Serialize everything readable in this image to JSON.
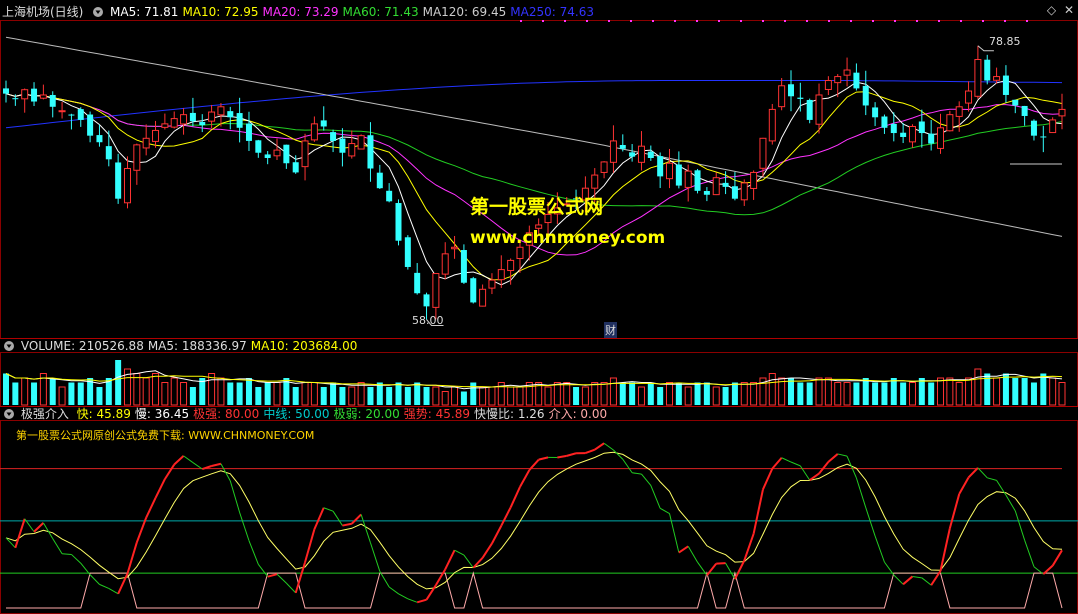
{
  "main_header": {
    "stock": "上海机场(日线)",
    "items": [
      {
        "label": "MA5: 71.81",
        "color": "#ffffff"
      },
      {
        "label": "MA10: 72.95",
        "color": "#ffff00"
      },
      {
        "label": "MA20: 73.29",
        "color": "#ff33ff"
      },
      {
        "label": "MA60: 71.43",
        "color": "#33dd33"
      },
      {
        "label": "MA120: 69.45",
        "color": "#cccccc"
      },
      {
        "label": "MA250: 74.63",
        "color": "#3333ff"
      }
    ]
  },
  "volume_header": {
    "items": [
      {
        "label": "VOLUME: 210526.88",
        "color": "#dddddd"
      },
      {
        "label": "MA5: 188336.97",
        "color": "#dddddd"
      },
      {
        "label": "MA10: 203684.00",
        "color": "#ffff00"
      }
    ]
  },
  "indicator_header": {
    "name": "极强介入",
    "items": [
      {
        "label": "快: 45.89",
        "color": "#ffff00"
      },
      {
        "label": "慢: 36.45",
        "color": "#ffffff"
      },
      {
        "label": "极强: 80.00",
        "color": "#ff3333"
      },
      {
        "label": "中线: 50.00",
        "color": "#00cccc"
      },
      {
        "label": "极弱: 20.00",
        "color": "#33dd33"
      },
      {
        "label": "强势: 45.89",
        "color": "#ff3333"
      },
      {
        "label": "快慢比: 1.26",
        "color": "#dddddd"
      },
      {
        "label": "介入: 0.00",
        "color": "#ffaaaa"
      }
    ]
  },
  "watermark": {
    "line1": "第一股票公式网",
    "line2": "www.chnmoney.com",
    "sub": "第一股票公式网原创公式免费下载: WWW.CHNMONEY.COM"
  },
  "annotations": {
    "high": "78.85",
    "low": "58.00",
    "marker": "财"
  },
  "icons": [
    "collapse-triangle-icon",
    "diamond-icon",
    "close-icon"
  ],
  "chart_data": {
    "type": "candlestick",
    "panels": [
      "price",
      "volume",
      "indicator"
    ],
    "price": {
      "high_label": 78.85,
      "low_label": 58.0,
      "close": [
        75.2,
        74.8,
        75.5,
        74.6,
        75.1,
        74.2,
        73.9,
        73.6,
        73.2,
        72.0,
        71.5,
        70.2,
        67.2,
        69.5,
        71.3,
        71.8,
        72.4,
        72.9,
        73.3,
        73.6,
        73.1,
        72.8,
        73.8,
        74.2,
        73.4,
        72.6,
        71.6,
        70.7,
        70.3,
        70.9,
        69.9,
        69.2,
        71.6,
        72.9,
        72.7,
        71.6,
        70.7,
        71.4,
        72.0,
        69.5,
        68.0,
        67.0,
        64.0,
        62.0,
        60.0,
        59.0,
        61.5,
        63.0,
        63.5,
        60.8,
        59.3,
        60.3,
        61.0,
        61.8,
        62.5,
        63.5,
        64.6,
        65.2,
        66.0,
        66.5,
        66.8,
        67.2,
        68.0,
        69.0,
        70.0,
        71.6,
        71.0,
        70.4,
        71.2,
        70.3,
        68.9,
        69.9,
        68.2,
        69.3,
        67.8,
        67.5,
        68.8,
        68.1,
        67.2,
        68.4,
        69.2,
        71.8,
        74.0,
        75.8,
        75.0,
        74.8,
        73.2,
        75.1,
        76.2,
        76.5,
        77.0,
        75.6,
        74.3,
        73.4,
        72.6,
        72.2,
        71.9,
        72.7,
        72.2,
        71.4,
        72.6,
        73.6,
        74.2,
        75.4,
        77.8,
        76.2,
        76.5,
        75.1,
        74.3,
        73.5,
        72.0,
        71.9,
        73.2,
        74.0
      ]
    },
    "volume": {
      "ma5": 188336.97,
      "ma10": 203684.0,
      "last": 210526.88,
      "values": [
        0.7,
        0.5,
        0.6,
        0.5,
        0.7,
        0.6,
        0.4,
        0.5,
        0.5,
        0.6,
        0.4,
        0.6,
        1.0,
        0.8,
        0.7,
        0.6,
        0.7,
        0.5,
        0.6,
        0.5,
        0.4,
        0.6,
        0.7,
        0.6,
        0.5,
        0.5,
        0.6,
        0.4,
        0.5,
        0.5,
        0.6,
        0.4,
        0.5,
        0.5,
        0.4,
        0.5,
        0.4,
        0.4,
        0.5,
        0.4,
        0.5,
        0.4,
        0.5,
        0.4,
        0.5,
        0.4,
        0.4,
        0.3,
        0.4,
        0.3,
        0.5,
        0.4,
        0.4,
        0.5,
        0.4,
        0.4,
        0.5,
        0.5,
        0.4,
        0.5,
        0.5,
        0.4,
        0.4,
        0.5,
        0.5,
        0.6,
        0.5,
        0.5,
        0.4,
        0.5,
        0.4,
        0.5,
        0.5,
        0.4,
        0.5,
        0.5,
        0.4,
        0.4,
        0.5,
        0.5,
        0.5,
        0.6,
        0.7,
        0.6,
        0.6,
        0.5,
        0.5,
        0.6,
        0.6,
        0.5,
        0.5,
        0.5,
        0.6,
        0.5,
        0.5,
        0.6,
        0.5,
        0.5,
        0.6,
        0.5,
        0.6,
        0.6,
        0.5,
        0.6,
        0.8,
        0.7,
        0.6,
        0.7,
        0.6,
        0.6,
        0.5,
        0.7,
        0.6,
        0.5
      ]
    },
    "indicator": {
      "levels": {
        "strong": 80,
        "mid": 50,
        "weak": 20
      },
      "fast_last": 45.89,
      "slow_last": 36.45,
      "ratio": 1.26,
      "entry": 0.0
    }
  }
}
